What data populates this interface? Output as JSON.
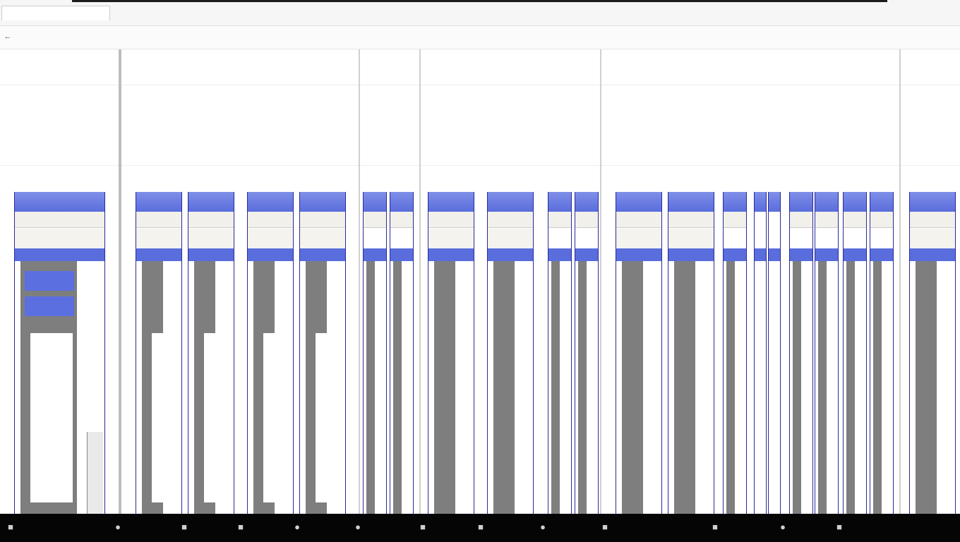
{
  "window_title": "",
  "address": {
    "back_icon": "arrow-left-icon",
    "url": ""
  },
  "tabs": [
    {
      "label": ""
    },
    {
      "label": ""
    },
    {
      "label": ""
    },
    {
      "label": ""
    },
    {
      "label": ""
    },
    {
      "label": ""
    },
    {
      "label": ""
    },
    {
      "label": ""
    },
    {
      "label": ""
    },
    {
      "label": ""
    },
    {
      "label": ""
    }
  ],
  "bookmarks": [
    {
      "label": "",
      "link": true
    },
    {
      "label": "",
      "link": true
    },
    {
      "label": "",
      "link": true
    },
    {
      "label": "",
      "link": true
    },
    {
      "label": "",
      "link": true
    },
    {
      "label": "",
      "link": true
    },
    {
      "label": "",
      "link": true
    }
  ],
  "notice": {
    "headline": "",
    "body": ""
  },
  "colors": {
    "panel_header": "#5a6ddc",
    "taskbar": "#050505",
    "link": "#0a5aa8"
  },
  "taskbar": {
    "icons": [
      "app-icon",
      "app-icon",
      "app-icon",
      "app-icon",
      "app-icon",
      "app-icon",
      "app-icon",
      "app-icon",
      "app-icon",
      "app-icon",
      "app-icon",
      "app-icon",
      "app-icon"
    ]
  }
}
